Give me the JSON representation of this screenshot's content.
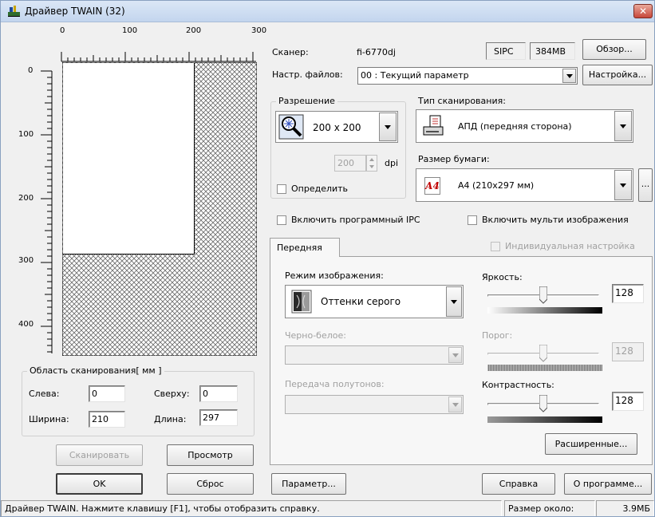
{
  "window": {
    "title": "Драйвер TWAIN (32)",
    "close_label": "✕"
  },
  "ruler": {
    "h_ticks": [
      "0",
      "100",
      "200",
      "300"
    ],
    "v_ticks": [
      "0",
      "100",
      "200",
      "300",
      "400"
    ]
  },
  "scan_area": {
    "legend": "Область сканирования[ мм ]",
    "left_label": "Слева:",
    "left_value": "0",
    "top_label": "Сверху:",
    "top_value": "0",
    "width_label": "Ширина:",
    "width_value": "210",
    "length_label": "Длина:",
    "length_value": "297"
  },
  "buttons": {
    "scan": "Сканировать",
    "preview": "Просмотр",
    "ok": "OK",
    "reset": "Сброс",
    "browse": "Обзор...",
    "setup": "Настройка...",
    "paper_more": "...",
    "advanced": "Расширенные...",
    "parameter": "Параметр...",
    "help": "Справка",
    "about": "О программе..."
  },
  "scanner": {
    "label": "Сканер:",
    "value": "fi-6770dj",
    "ipc": "SIPC",
    "memory": "384MB"
  },
  "file_settings": {
    "label": "Настр. файлов:",
    "value": "00 : Текущий параметр"
  },
  "resolution": {
    "legend": "Разрешение",
    "value": "200 x 200",
    "custom_value": "200",
    "unit": "dpi",
    "detect_label": "Определить"
  },
  "scan_type": {
    "label": "Тип сканирования:",
    "value": "АПД (передняя сторона)"
  },
  "paper_size": {
    "label": "Размер бумаги:",
    "value": "A4 (210x297 мм)",
    "icon_text": "A4"
  },
  "checkboxes": {
    "software_ipc": "Включить программный IPC",
    "multi_image": "Включить мульти изображения"
  },
  "tab": {
    "front": "Передняя",
    "individual": "Индивидуальная настройка"
  },
  "image_mode": {
    "label": "Режим изображения:",
    "value": "Оттенки серого"
  },
  "bw": {
    "label": "Черно-белое:",
    "value": ""
  },
  "halftone": {
    "label": "Передача полутонов:",
    "value": ""
  },
  "brightness": {
    "label": "Яркость:",
    "value": "128",
    "level": 0.5
  },
  "threshold": {
    "label": "Порог:",
    "value": "128",
    "level": 0.5
  },
  "contrast": {
    "label": "Контрастность:",
    "value": "128",
    "level": 0.5
  },
  "statusbar": {
    "message": "Драйвер TWAIN. Нажмите клавишу [F1], чтобы отобразить справку.",
    "size_label": "Размер около:",
    "size_value": "3.9МБ"
  }
}
